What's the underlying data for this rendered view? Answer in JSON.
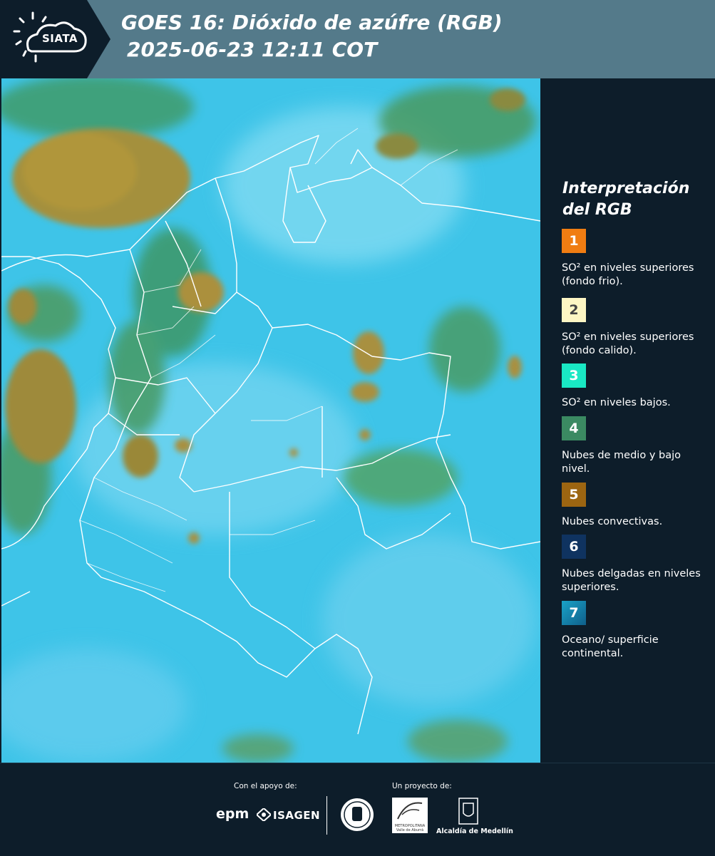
{
  "header": {
    "logo_text": "SIATA",
    "title_line1": "GOES 16: Dióxido de azúfre (RGB)",
    "title_line2": "2025-06-23 12:11 COT"
  },
  "map": {
    "description_icon": "satellite-rgb-image",
    "colors": {
      "background": "#3ec4e8",
      "borders": "#ffffff"
    }
  },
  "legend": {
    "title": "Interpretación del RGB",
    "items": [
      {
        "number": "1",
        "color": "#f07d12",
        "text": "SO² en niveles superiores (fondo frio)."
      },
      {
        "number": "2",
        "color": "#fdf6c4",
        "text": "SO² en niveles superiores (fondo calido)."
      },
      {
        "number": "3",
        "color": "#19e8c4",
        "text": "SO² en niveles bajos."
      },
      {
        "number": "4",
        "color": "#3b8a62",
        "text": "Nubes de medio y bajo nivel."
      },
      {
        "number": "5",
        "color": "#9c6511",
        "text": "Nubes convectivas."
      },
      {
        "number": "6",
        "color": "#0f3360",
        "text": "Nubes delgadas en niveles superiores."
      },
      {
        "number": "7",
        "color": "#1a8cb4",
        "text": "Oceano/ superficie continental."
      }
    ]
  },
  "footer": {
    "support_label": "Con el apoyo de:",
    "project_label": "Un proyecto de:",
    "epm": "epm",
    "isagen": "ISAGEN",
    "amva": "METROPOLITANA Valle de Aburrá",
    "medellin": "Alcaldía de Medellín"
  }
}
